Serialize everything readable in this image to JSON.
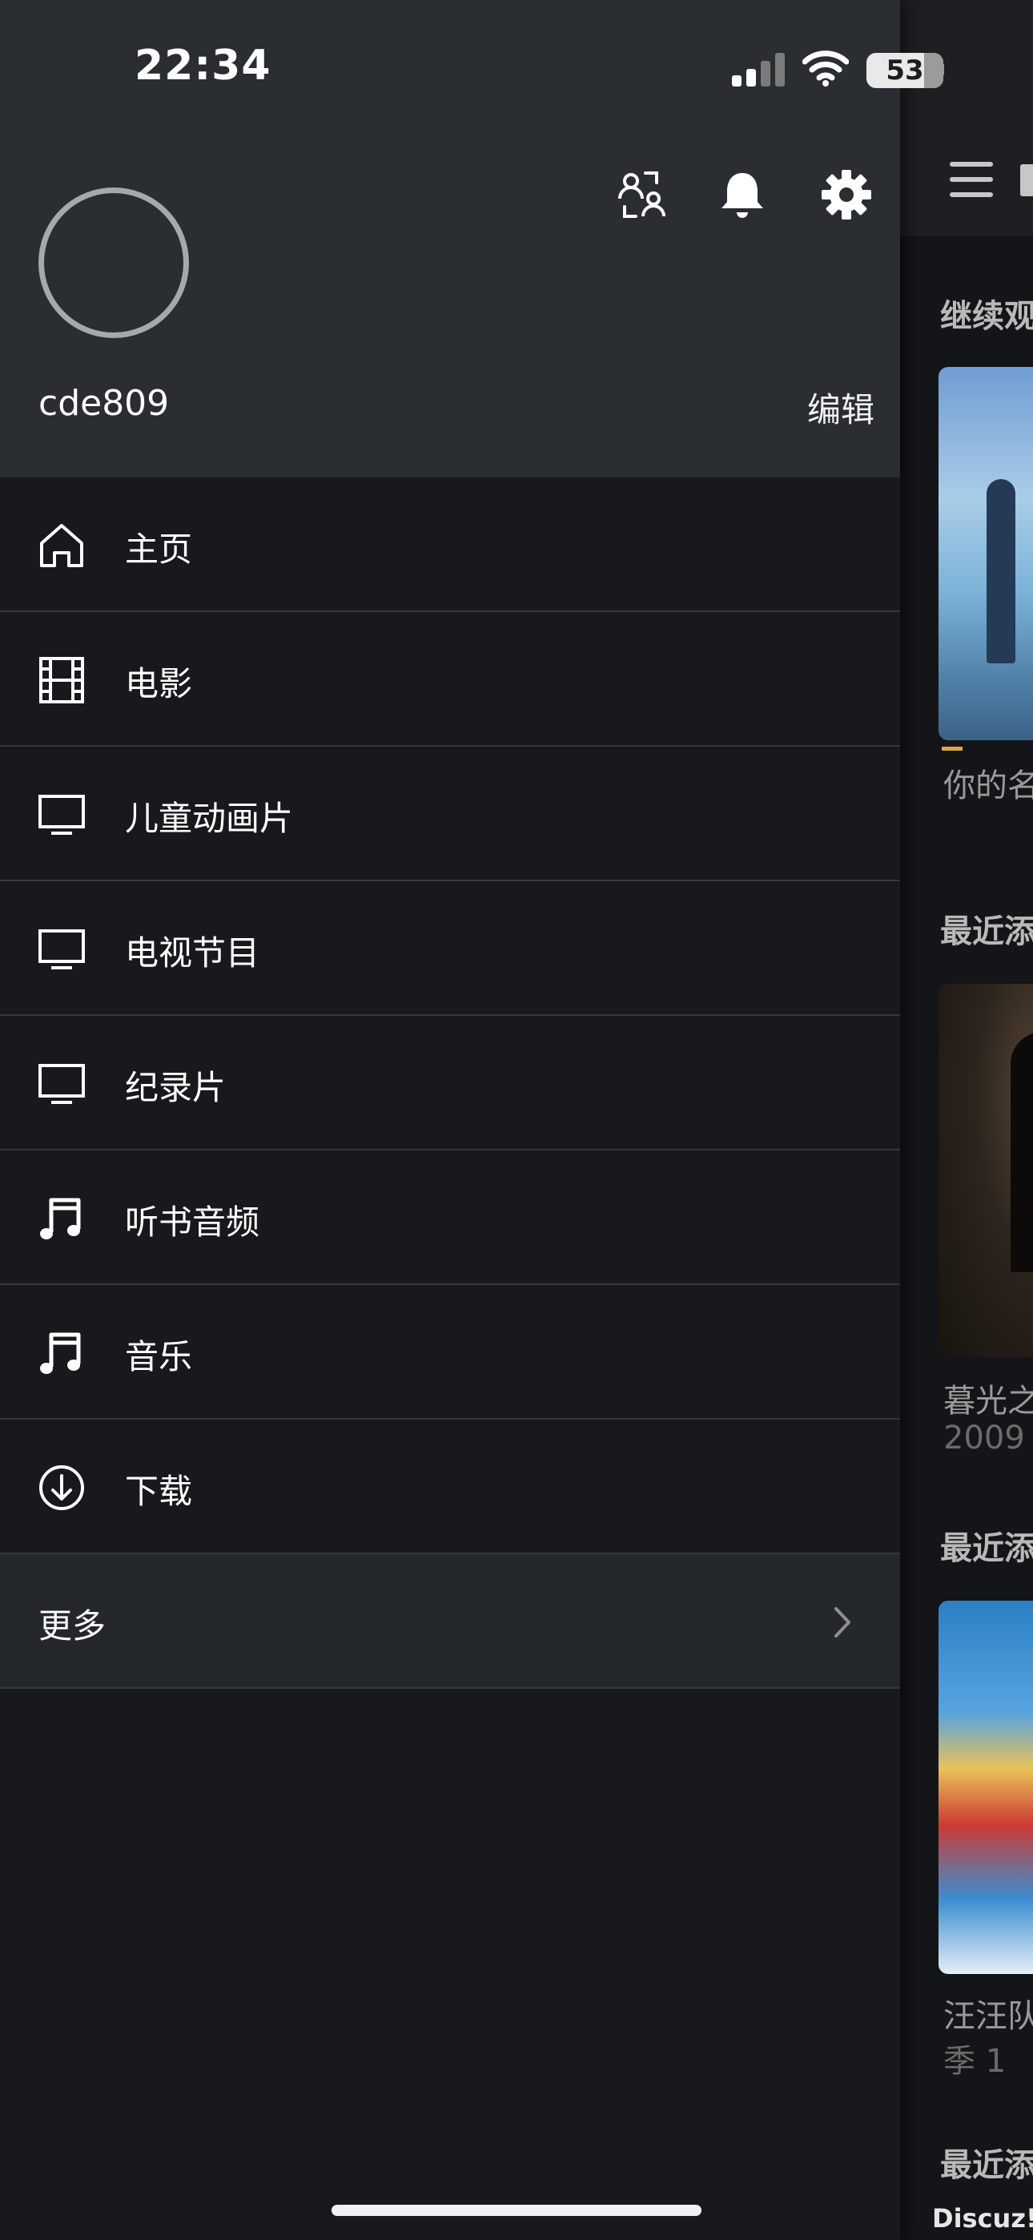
{
  "status_bar": {
    "time": "22:34",
    "battery": "53",
    "icons": [
      "signal-icon",
      "wifi-icon",
      "battery-icon"
    ]
  },
  "drawer": {
    "header": {
      "icons": [
        "switch-user-icon",
        "bell-icon",
        "gear-icon"
      ],
      "username": "cde809",
      "edit_label": "编辑"
    },
    "menu": [
      {
        "label": "主页",
        "icon": "home-icon"
      },
      {
        "label": "电影",
        "icon": "film-icon"
      },
      {
        "label": "儿童动画片",
        "icon": "tv-icon"
      },
      {
        "label": "电视节目",
        "icon": "tv-icon"
      },
      {
        "label": "纪录片",
        "icon": "tv-icon"
      },
      {
        "label": "听书音频",
        "icon": "music-note-icon"
      },
      {
        "label": "音乐",
        "icon": "music-note-icon"
      },
      {
        "label": "下载",
        "icon": "download-icon"
      }
    ],
    "more": {
      "label": "更多",
      "icon": "chevron-right-icon"
    }
  },
  "background_page": {
    "sections": [
      "继续观",
      "最近添",
      "最近添",
      "最近添"
    ],
    "items": [
      {
        "title": "你的名",
        "progress_fraction": 0.15
      },
      {
        "title": "暮光之",
        "subtitle": "2009"
      },
      {
        "title": "汪汪队",
        "subtitle": "季 1"
      }
    ],
    "watermark": "Discuz!"
  },
  "colors": {
    "drawer_bg": "#18191c",
    "header_bg": "#2a2d31",
    "divider": "#34373b",
    "progress_accent": "#e3a53b"
  }
}
